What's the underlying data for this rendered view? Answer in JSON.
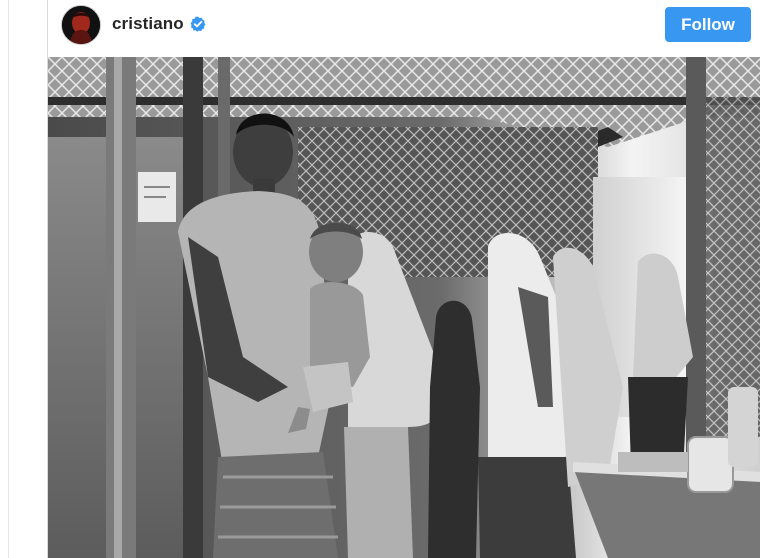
{
  "post": {
    "username": "cristiano",
    "verified": true,
    "follow_label": "Follow",
    "avatar_icon": "profile-avatar-icon",
    "verified_icon": "verified-badge-icon",
    "photo": {
      "style": "black-and-white",
      "subject": "photo"
    }
  },
  "colors": {
    "follow_button": "#3897f0",
    "verified_badge": "#3897f0",
    "username_text": "#262626"
  }
}
